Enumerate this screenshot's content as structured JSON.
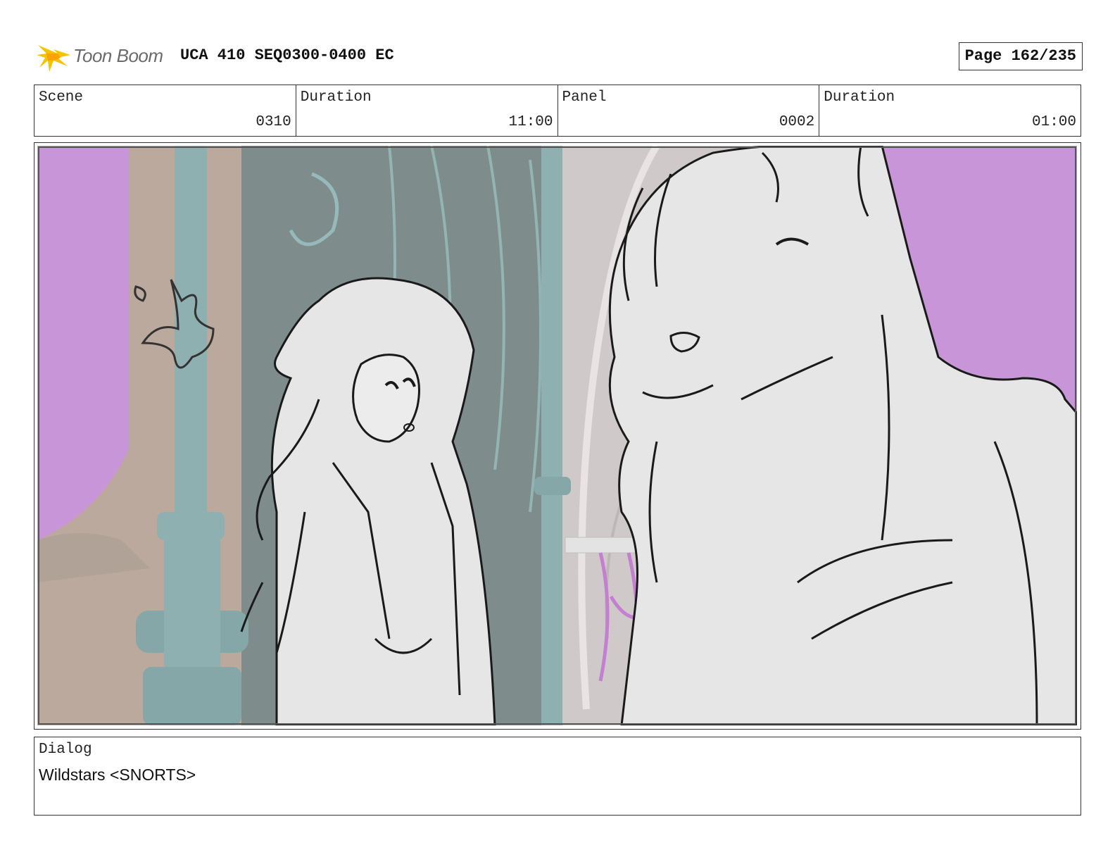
{
  "header": {
    "logo_text": "Toon Boom",
    "title": "UCA 410 SEQ0300-0400 EC",
    "page": "Page 162/235"
  },
  "info": {
    "scene_label": "Scene",
    "scene_value": "0310",
    "scene_duration_label": "Duration",
    "scene_duration_value": "11:00",
    "panel_label": "Panel",
    "panel_value": "0002",
    "panel_duration_label": "Duration",
    "panel_duration_value": "01:00"
  },
  "dialog": {
    "label": "Dialog",
    "text": "Wildstars <SNORTS>"
  },
  "colors": {
    "logo_accent": "#f5c400",
    "backdrop_purple": "#c896d8",
    "pillar_teal": "#8fb0b0",
    "curtain_grey": "#7f8c8c",
    "drape_tan": "#bba99e",
    "sketch_fill": "#e6e6e6"
  }
}
